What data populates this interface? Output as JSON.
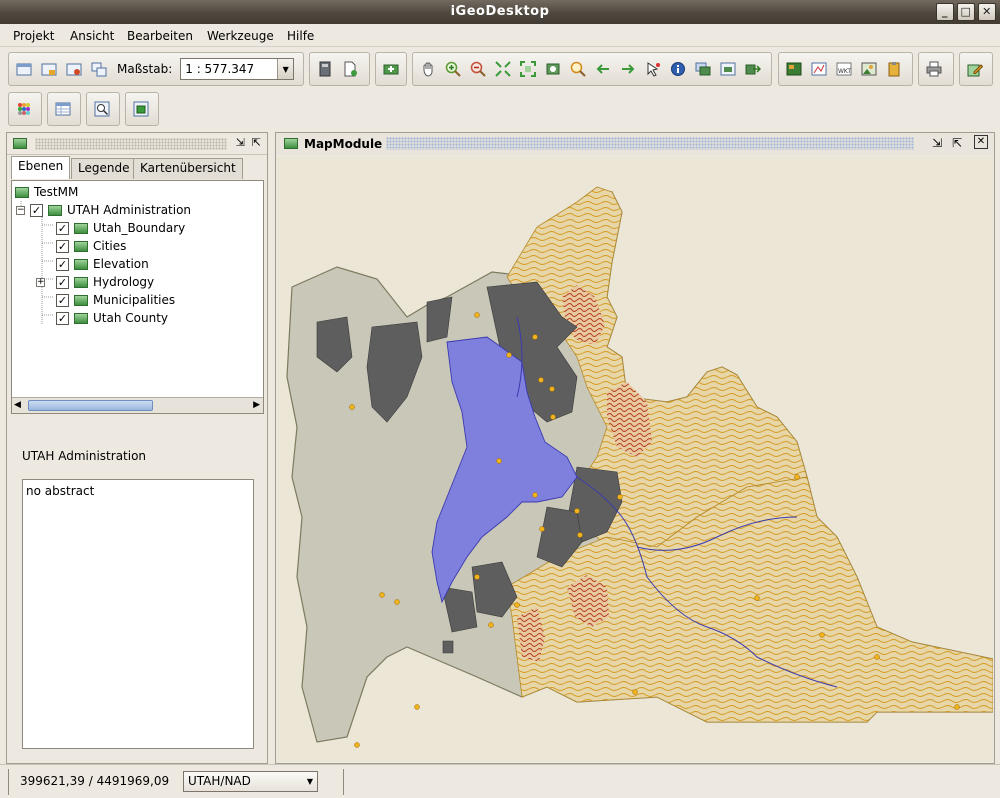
{
  "window": {
    "title": "iGeoDesktop"
  },
  "menu": [
    "Projekt",
    "Ansicht",
    "Bearbeiten",
    "Werkzeuge",
    "Hilfe"
  ],
  "toolbar": {
    "scale_label": "Maßstab:",
    "scale_value": "1 : 577.347"
  },
  "left_panel": {
    "tabs": [
      "Ebenen",
      "Legende",
      "Kartenübersicht"
    ],
    "active_tab": "Ebenen",
    "tree": {
      "root": "TestMM",
      "group": "UTAH Administration",
      "layers": [
        {
          "label": "Utah_Boundary",
          "checked": true,
          "expandable": false
        },
        {
          "label": "Cities",
          "checked": true,
          "expandable": false
        },
        {
          "label": "Elevation",
          "checked": true,
          "expandable": false
        },
        {
          "label": "Hydrology",
          "checked": true,
          "expandable": true
        },
        {
          "label": "Municipalities",
          "checked": true,
          "expandable": false
        },
        {
          "label": "Utah County",
          "checked": true,
          "expandable": false
        }
      ]
    },
    "abstract_title": "UTAH Administration",
    "abstract_text": "no abstract"
  },
  "map_panel": {
    "title": "MapModule"
  },
  "status": {
    "coordinates": "399621,39 / 4491969,09",
    "crs": "UTAH/NAD"
  },
  "colors": {
    "county": "#c9c7b8",
    "lake": "#7f7fdd",
    "municipality": "#5e5e5e",
    "contour": "#d7a23a",
    "city": "#f2b21c"
  }
}
